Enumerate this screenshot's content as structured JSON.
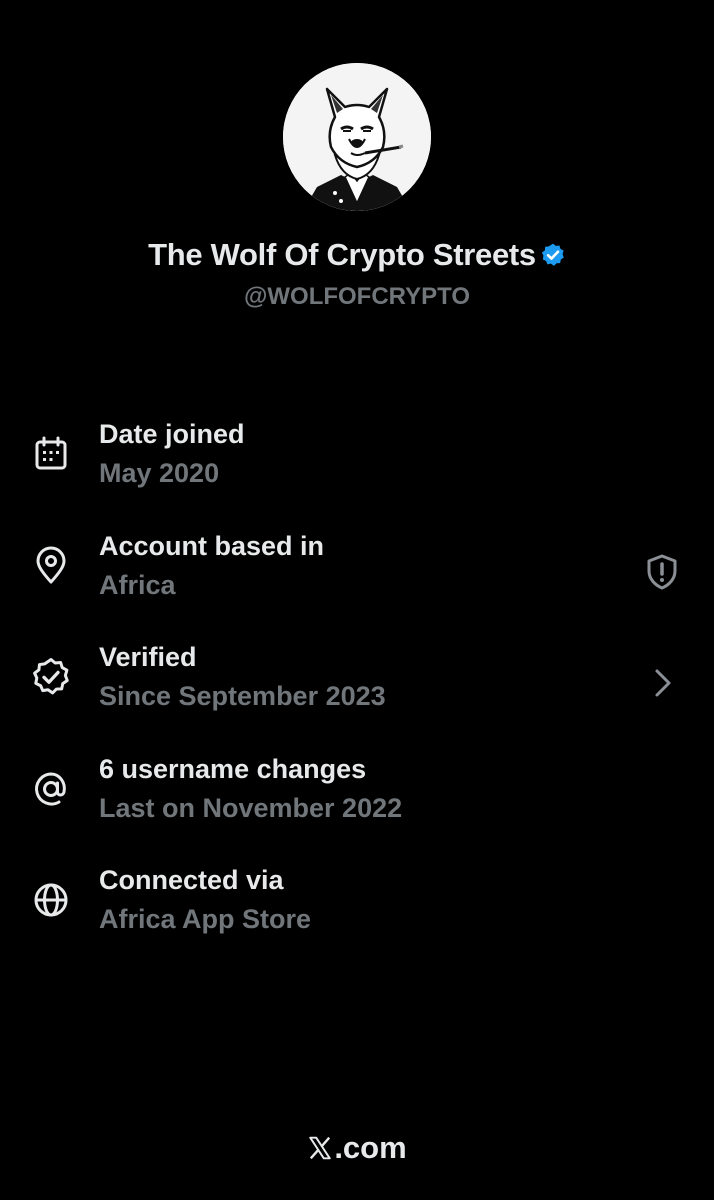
{
  "profile": {
    "display_name": "The Wolf Of Crypto Streets",
    "handle": "@WOLFOFCRYPTO",
    "verified_badge_color": "#1d9bf0"
  },
  "info_rows": [
    {
      "icon": "calendar-icon",
      "title": "Date joined",
      "subtitle": "May 2020"
    },
    {
      "icon": "location-pin-icon",
      "title": "Account based in",
      "subtitle": "Africa",
      "trailing_icon": "shield-alert-icon"
    },
    {
      "icon": "verified-check-icon",
      "title": "Verified",
      "subtitle": "Since September 2023",
      "trailing_icon": "chevron-right-icon"
    },
    {
      "icon": "at-sign-icon",
      "title": "6 username changes",
      "subtitle": "Last on November 2022"
    },
    {
      "icon": "globe-icon",
      "title": "Connected via",
      "subtitle": "Africa App Store"
    }
  ],
  "footer": {
    "domain_suffix": ".com"
  },
  "colors": {
    "background": "#000000",
    "primary_text": "#e7e9ea",
    "secondary_text": "#71767b"
  }
}
